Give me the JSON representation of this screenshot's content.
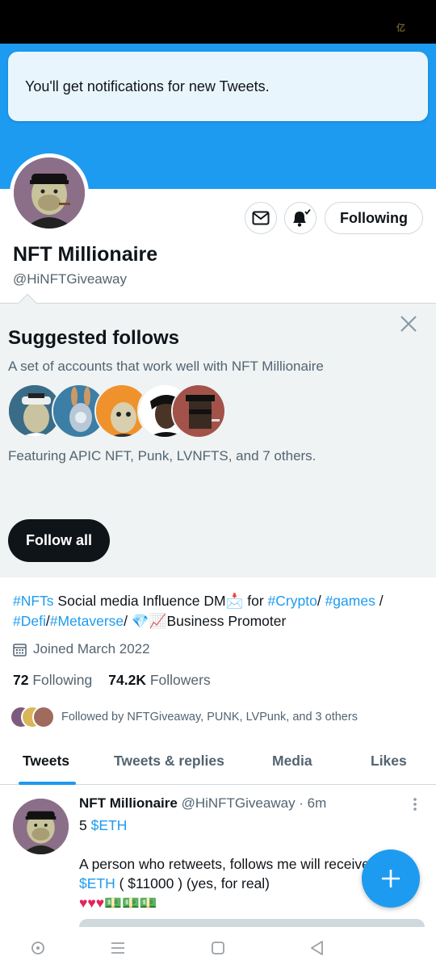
{
  "status_bar": {
    "right_text": "亿"
  },
  "toast": {
    "text": "You'll get notifications for new Tweets."
  },
  "profile": {
    "name": "NFT Millionaire",
    "handle": "@HiNFTGiveaway",
    "follow_button": "Following"
  },
  "suggested": {
    "title": "Suggested follows",
    "subtitle": "A set of accounts that work well with NFT Millionaire",
    "featuring": "Featuring APIC NFT, Punk, LVNFTS, and 7 others.",
    "follow_all": "Follow all"
  },
  "bio": {
    "tag_nfts": "#NFTs",
    "text1": " Social media Influence DM",
    "emoji_inbox": "📩",
    "text2": " for ",
    "tag_crypto": "#Crypto",
    "sep1": "/ ",
    "tag_games": "#games",
    "sep2": " /",
    "tag_defi": "#Defi",
    "sep3": "/",
    "tag_metaverse": "#Metaverse",
    "sep4": "/ ",
    "emojis": "💎📈",
    "text3": "Business Promoter"
  },
  "joined": "Joined March 2022",
  "stats": {
    "following_count": "72",
    "following_label": "Following",
    "followers_count": "74.2K",
    "followers_label": "Followers"
  },
  "followed_by": "Followed by NFTGiveaway, PUNK, LVPunk, and 3 others",
  "tabs": [
    "Tweets",
    "Tweets & replies",
    "Media",
    "Likes"
  ],
  "tweet": {
    "author": "NFT Millionaire",
    "handle_time": "@HiNFTGiveaway · 6m",
    "line1_prefix": "5 ",
    "line1_cashtag": "$ETH",
    "line3": "A person who retweets, follows me will receive",
    "line4_cashtag": "$ETH",
    "line4_text": " ( $11000 ) (yes, for real)",
    "line5": "♥♥♥💵💵💵"
  },
  "colors": {
    "accent": "#1d9bf0",
    "text": "#0f1419",
    "muted": "#536471",
    "heart": "#e0245e"
  }
}
